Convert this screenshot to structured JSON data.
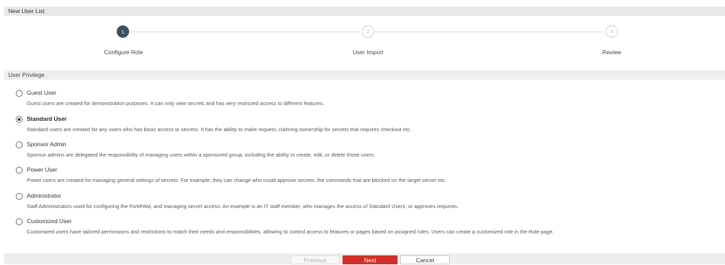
{
  "window": {
    "title": "New User List"
  },
  "stepper": {
    "steps": [
      {
        "number": "1",
        "label": "Configure Role",
        "state": "active"
      },
      {
        "number": "2",
        "label": "User Import",
        "state": "inactive"
      },
      {
        "number": "3",
        "label": "Review",
        "state": "inactive"
      }
    ]
  },
  "section": {
    "title": "User Privilege"
  },
  "options": [
    {
      "title": "Guest User",
      "selected": false,
      "description": "Guest users are created for demonstration purposes. It can only view secrets and has very restricted access to different features."
    },
    {
      "title": "Standard User",
      "selected": true,
      "description": "Standard users are created for any users who has basic access to secrets. It has the ability to make request, claiming ownership for secrets that requires checkout etc."
    },
    {
      "title": "Sponsor Admin",
      "selected": false,
      "description": "Sponsor admins are delegated the responsibility of managing users within a sponsored group, including the ability to create, edit, or delete those users."
    },
    {
      "title": "Power User",
      "selected": false,
      "description": "Power users are created for managing general settings of secrets. For example, they can change who could approve secrets, the commands that are blocked on the target server etc."
    },
    {
      "title": "Administrator",
      "selected": false,
      "description": "Staff Administrators used for configuring the FortiPAM, and managing secret access. An example is an IT staff member, who manages the access of Standard Users, or approves requests."
    },
    {
      "title": "Customized User",
      "selected": false,
      "description": "Customized users have tailored permissions and restrictions to match their needs and responsibilities, allowing to control access to features or pages based on assigned roles. Users can create a customized role in the Role page."
    }
  ],
  "footer": {
    "previous_label": "Previous",
    "next_label": "Next",
    "cancel_label": "Cancel"
  },
  "colors": {
    "accent": "#d32f27",
    "step_active": "#3f4f63"
  }
}
